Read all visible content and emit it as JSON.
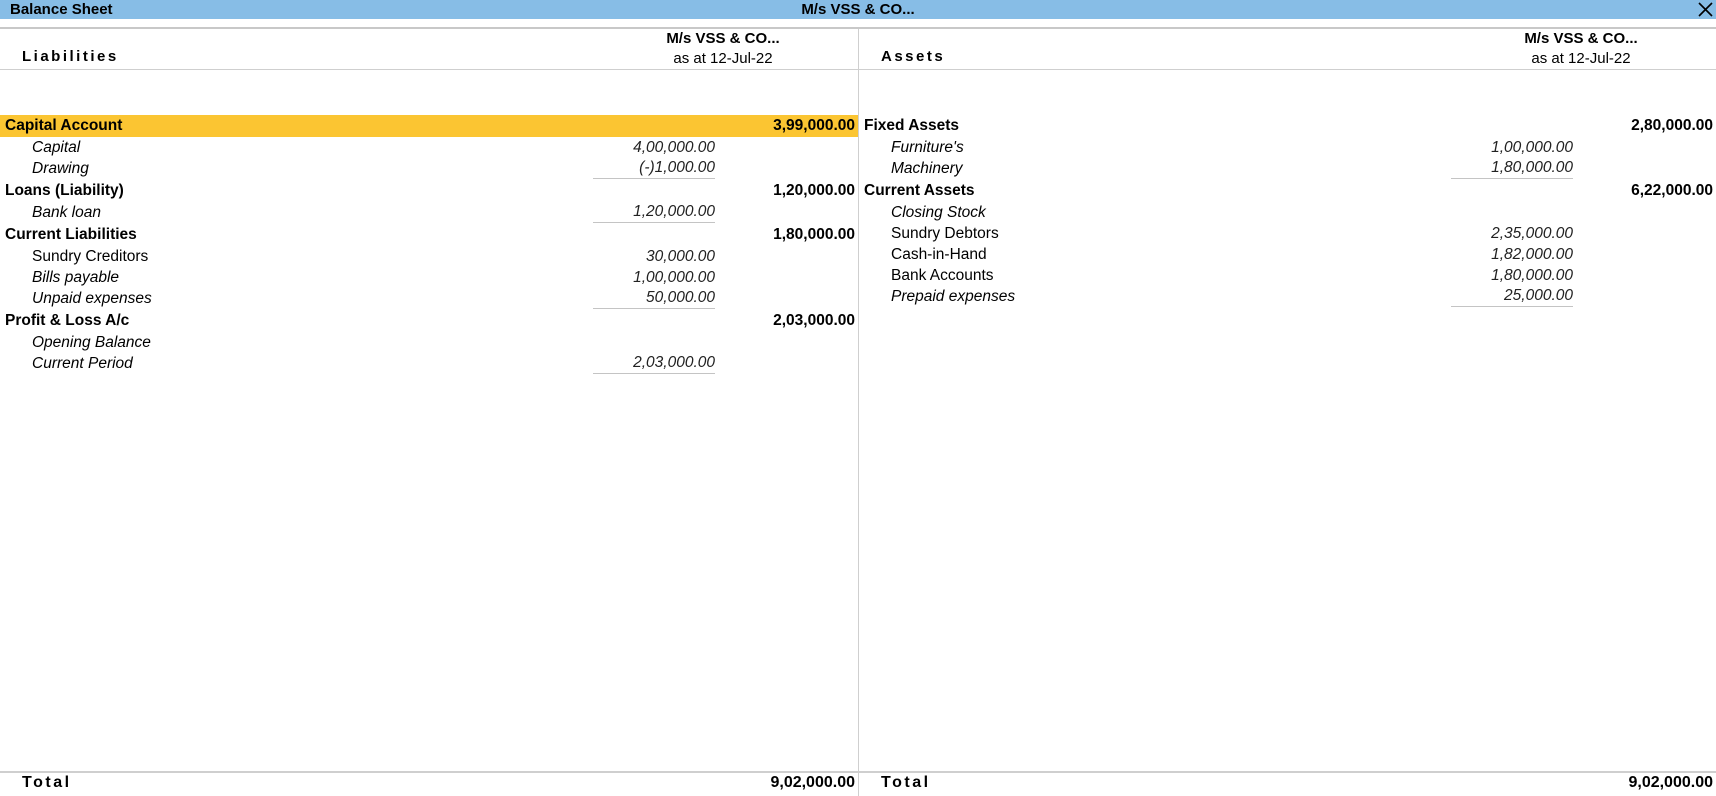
{
  "titlebar": {
    "title": "Balance Sheet",
    "company": "M/s VSS & CO...",
    "close_icon": "close-icon"
  },
  "liabilities": {
    "label": "Liabilities",
    "company": "M/s VSS & CO...",
    "as_at": "as at 12-Jul-22",
    "groups": [
      {
        "name": "Capital Account",
        "total": "3,99,000.00",
        "selected": true,
        "items": [
          {
            "name": "Capital",
            "value": "4,00,000.00",
            "italic": true
          },
          {
            "name": "Drawing",
            "value": "(-)1,000.00",
            "italic": true
          }
        ]
      },
      {
        "name": "Loans (Liability)",
        "total": "1,20,000.00",
        "items": [
          {
            "name": "Bank loan",
            "value": "1,20,000.00",
            "italic": true
          }
        ]
      },
      {
        "name": "Current Liabilities",
        "total": "1,80,000.00",
        "items": [
          {
            "name": "Sundry Creditors",
            "value": "30,000.00",
            "italic": false
          },
          {
            "name": "Bills payable",
            "value": "1,00,000.00",
            "italic": true
          },
          {
            "name": "Unpaid expenses",
            "value": "50,000.00",
            "italic": true
          }
        ]
      },
      {
        "name": "Profit & Loss A/c",
        "total": "2,03,000.00",
        "items": [
          {
            "name": "Opening Balance",
            "value": "",
            "italic": true
          },
          {
            "name": "Current Period",
            "value": "2,03,000.00",
            "italic": true
          }
        ]
      }
    ],
    "total_label": "Total",
    "total": "9,02,000.00"
  },
  "assets": {
    "label": "Assets",
    "company": "M/s VSS & CO...",
    "as_at": "as at 12-Jul-22",
    "groups": [
      {
        "name": "Fixed Assets",
        "total": "2,80,000.00",
        "items": [
          {
            "name": "Furniture's",
            "value": "1,00,000.00",
            "italic": true
          },
          {
            "name": "Machinery",
            "value": "1,80,000.00",
            "italic": true
          }
        ]
      },
      {
        "name": "Current Assets",
        "total": "6,22,000.00",
        "items": [
          {
            "name": "Closing Stock",
            "value": "",
            "italic": true
          },
          {
            "name": "Sundry Debtors",
            "value": "2,35,000.00",
            "italic": false
          },
          {
            "name": "Cash-in-Hand",
            "value": "1,82,000.00",
            "italic": false
          },
          {
            "name": "Bank Accounts",
            "value": "1,80,000.00",
            "italic": false
          },
          {
            "name": "Prepaid expenses",
            "value": "25,000.00",
            "italic": true
          }
        ]
      }
    ],
    "total_label": "Total",
    "total": "9,02,000.00"
  },
  "colors": {
    "titlebar": "#87bde6",
    "selected_row": "#fbc532"
  }
}
